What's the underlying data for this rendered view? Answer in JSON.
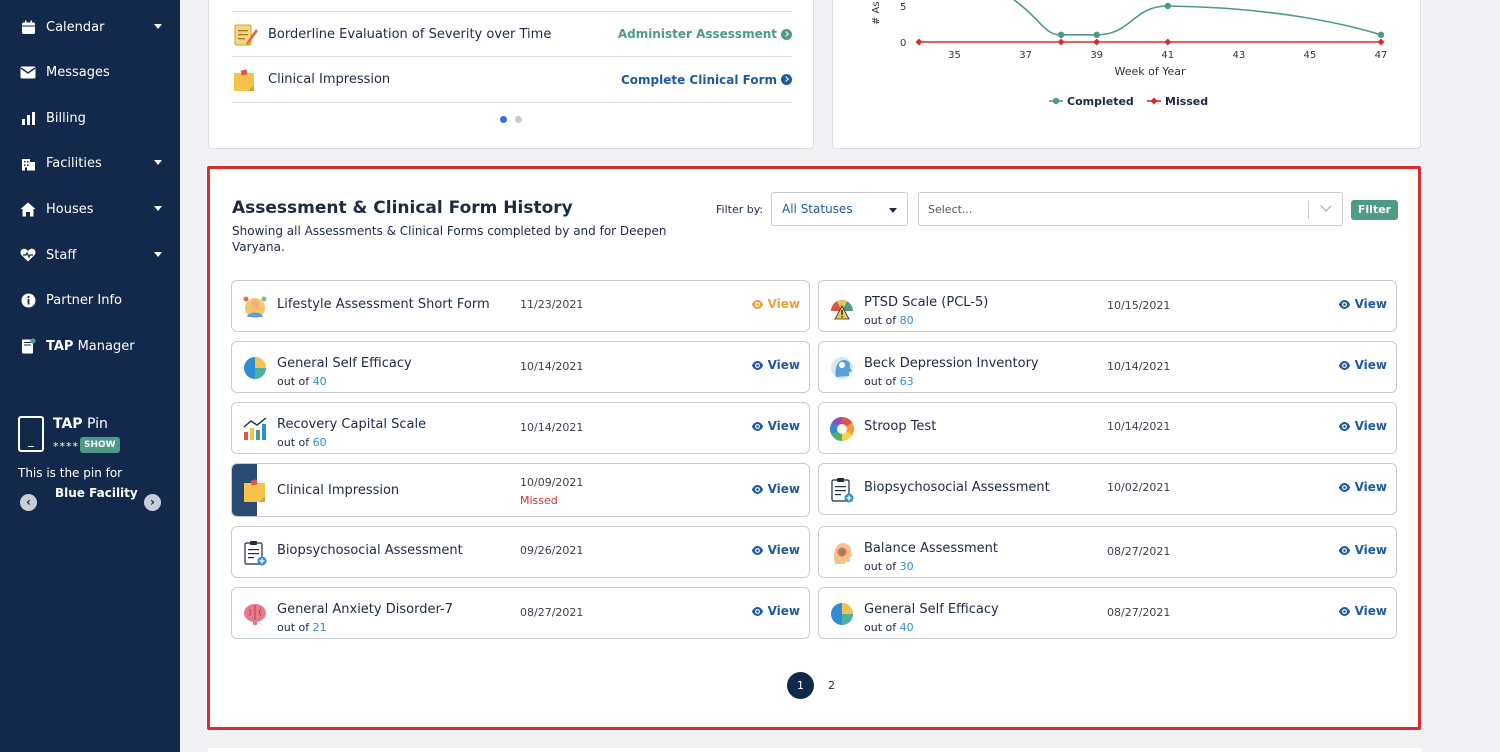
{
  "sidebar": {
    "items": [
      {
        "label": "Calendar",
        "icon": "calendar-icon",
        "has_caret": true
      },
      {
        "label": "Messages",
        "icon": "envelope-icon",
        "has_caret": false
      },
      {
        "label": "Billing",
        "icon": "bar-chart-icon",
        "has_caret": false
      },
      {
        "label": "Facilities",
        "icon": "building-icon",
        "has_caret": true
      },
      {
        "label": "Houses",
        "icon": "house-icon",
        "has_caret": true
      },
      {
        "label": "Staff",
        "icon": "heart-icon",
        "has_caret": true
      },
      {
        "label": "Partner Info",
        "icon": "info-icon",
        "has_caret": false
      },
      {
        "label_bold": "TAP",
        "label": " Manager",
        "icon": "tap-manager-icon",
        "has_caret": false
      }
    ],
    "tap_pin": {
      "title_bold": "TAP",
      "title": " Pin",
      "stars": "****",
      "show_label": "SHOW",
      "pin_for": "This is the pin for",
      "facility": "Blue Facility",
      "prev": "‹",
      "next": "›"
    }
  },
  "assessments_due": {
    "rows": [
      {
        "name": "Borderline Evaluation of Severity over Time",
        "action": "Administer Assessment",
        "action_color": "#4d9a86"
      },
      {
        "name": "Clinical Impression",
        "action": "Complete Clinical Form",
        "action_color": "#1f5a9e"
      }
    ]
  },
  "chart_data": {
    "type": "line",
    "xlabel": "Week of Year",
    "ylabel": "# As",
    "x_ticks": [
      35,
      37,
      39,
      41,
      43,
      45,
      47
    ],
    "y_ticks": [
      0,
      5
    ],
    "series": [
      {
        "name": "Completed",
        "color": "#4d9a86",
        "x": [
          38,
          39,
          41,
          47
        ],
        "y": [
          1,
          1,
          5,
          1
        ]
      },
      {
        "name": "Missed",
        "color": "#d32f2f",
        "x": [
          34,
          38,
          39,
          41,
          47
        ],
        "y": [
          0,
          0,
          0,
          0,
          0
        ]
      }
    ],
    "legend": [
      "Completed",
      "Missed"
    ]
  },
  "history": {
    "title": "Assessment & Clinical Form History",
    "subtitle": "Showing all Assessments & Clinical Forms completed by and for Deepen Varyana.",
    "filter_label": "Filter by:",
    "status_value": "All Statuses",
    "search_placeholder": "Select...",
    "filter_button": "Filter",
    "view_label": "View",
    "out_of_label": "out of",
    "items": [
      {
        "name": "Lifestyle Assessment Short Form",
        "date": "11/23/2021",
        "icon": "lifestyle-icon",
        "view_orange": true
      },
      {
        "name": "PTSD Scale (PCL-5)",
        "date": "10/15/2021",
        "icon": "gauge-warning-icon",
        "out_of": "80"
      },
      {
        "name": "General Self Efficacy",
        "date": "10/14/2021",
        "icon": "pie-chart-icon",
        "out_of": "40"
      },
      {
        "name": "Beck Depression Inventory",
        "date": "10/14/2021",
        "icon": "head-cloud-icon",
        "out_of": "63"
      },
      {
        "name": "Recovery Capital Scale",
        "date": "10/14/2021",
        "icon": "growth-chart-icon",
        "out_of": "60"
      },
      {
        "name": "Stroop Test",
        "date": "10/14/2021",
        "icon": "color-wheel-icon"
      },
      {
        "name": "Clinical Impression",
        "date": "10/09/2021",
        "icon": "sticky-note-icon",
        "missed": "Missed"
      },
      {
        "name": "Biopsychosocial Assessment",
        "date": "10/02/2021",
        "icon": "clipboard-icon"
      },
      {
        "name": "Biopsychosocial Assessment",
        "date": "09/26/2021",
        "icon": "clipboard-icon"
      },
      {
        "name": "Balance Assessment",
        "date": "08/27/2021",
        "icon": "head-balance-icon",
        "out_of": "30"
      },
      {
        "name": "General Anxiety Disorder-7",
        "date": "08/27/2021",
        "icon": "brain-icon",
        "out_of": "21"
      },
      {
        "name": "General Self Efficacy",
        "date": "08/27/2021",
        "icon": "pie-chart-icon",
        "out_of": "40"
      }
    ],
    "pages": [
      "1",
      "2"
    ]
  }
}
